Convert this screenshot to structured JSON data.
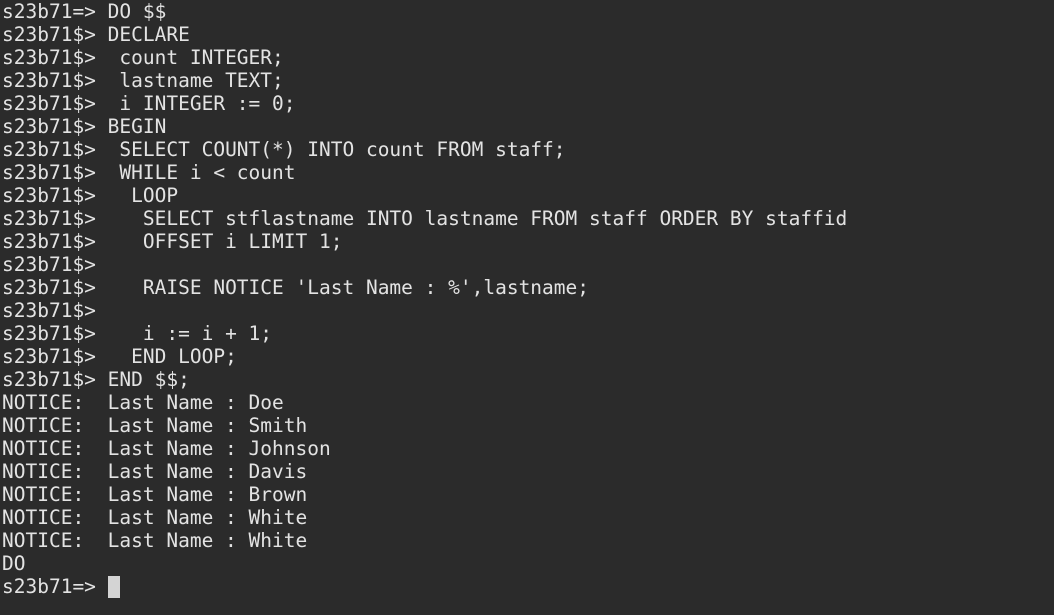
{
  "terminal": {
    "background": "#2b2b2b",
    "foreground": "#e3e3e3",
    "lines": [
      {
        "prompt": "s23b71=> ",
        "text": "DO $$"
      },
      {
        "prompt": "s23b71$> ",
        "text": "DECLARE"
      },
      {
        "prompt": "s23b71$> ",
        "text": " count INTEGER;"
      },
      {
        "prompt": "s23b71$> ",
        "text": " lastname TEXT;"
      },
      {
        "prompt": "s23b71$> ",
        "text": " i INTEGER := 0;"
      },
      {
        "prompt": "s23b71$> ",
        "text": "BEGIN"
      },
      {
        "prompt": "s23b71$> ",
        "text": " SELECT COUNT(*) INTO count FROM staff;"
      },
      {
        "prompt": "s23b71$> ",
        "text": " WHILE i < count"
      },
      {
        "prompt": "s23b71$> ",
        "text": "  LOOP"
      },
      {
        "prompt": "s23b71$> ",
        "text": "   SELECT stflastname INTO lastname FROM staff ORDER BY staffid"
      },
      {
        "prompt": "s23b71$> ",
        "text": "   OFFSET i LIMIT 1;"
      },
      {
        "prompt": "s23b71$> ",
        "text": ""
      },
      {
        "prompt": "s23b71$> ",
        "text": "   RAISE NOTICE 'Last Name : %',lastname;"
      },
      {
        "prompt": "s23b71$> ",
        "text": ""
      },
      {
        "prompt": "s23b71$> ",
        "text": "   i := i + 1;"
      },
      {
        "prompt": "s23b71$> ",
        "text": "  END LOOP;"
      },
      {
        "prompt": "s23b71$> ",
        "text": "END $$;"
      },
      {
        "prompt": "",
        "text": "NOTICE:  Last Name : Doe"
      },
      {
        "prompt": "",
        "text": "NOTICE:  Last Name : Smith"
      },
      {
        "prompt": "",
        "text": "NOTICE:  Last Name : Johnson"
      },
      {
        "prompt": "",
        "text": "NOTICE:  Last Name : Davis"
      },
      {
        "prompt": "",
        "text": "NOTICE:  Last Name : Brown"
      },
      {
        "prompt": "",
        "text": "NOTICE:  Last Name : White"
      },
      {
        "prompt": "",
        "text": "NOTICE:  Last Name : White"
      },
      {
        "prompt": "",
        "text": "DO"
      }
    ],
    "current_prompt": "s23b71=> "
  }
}
